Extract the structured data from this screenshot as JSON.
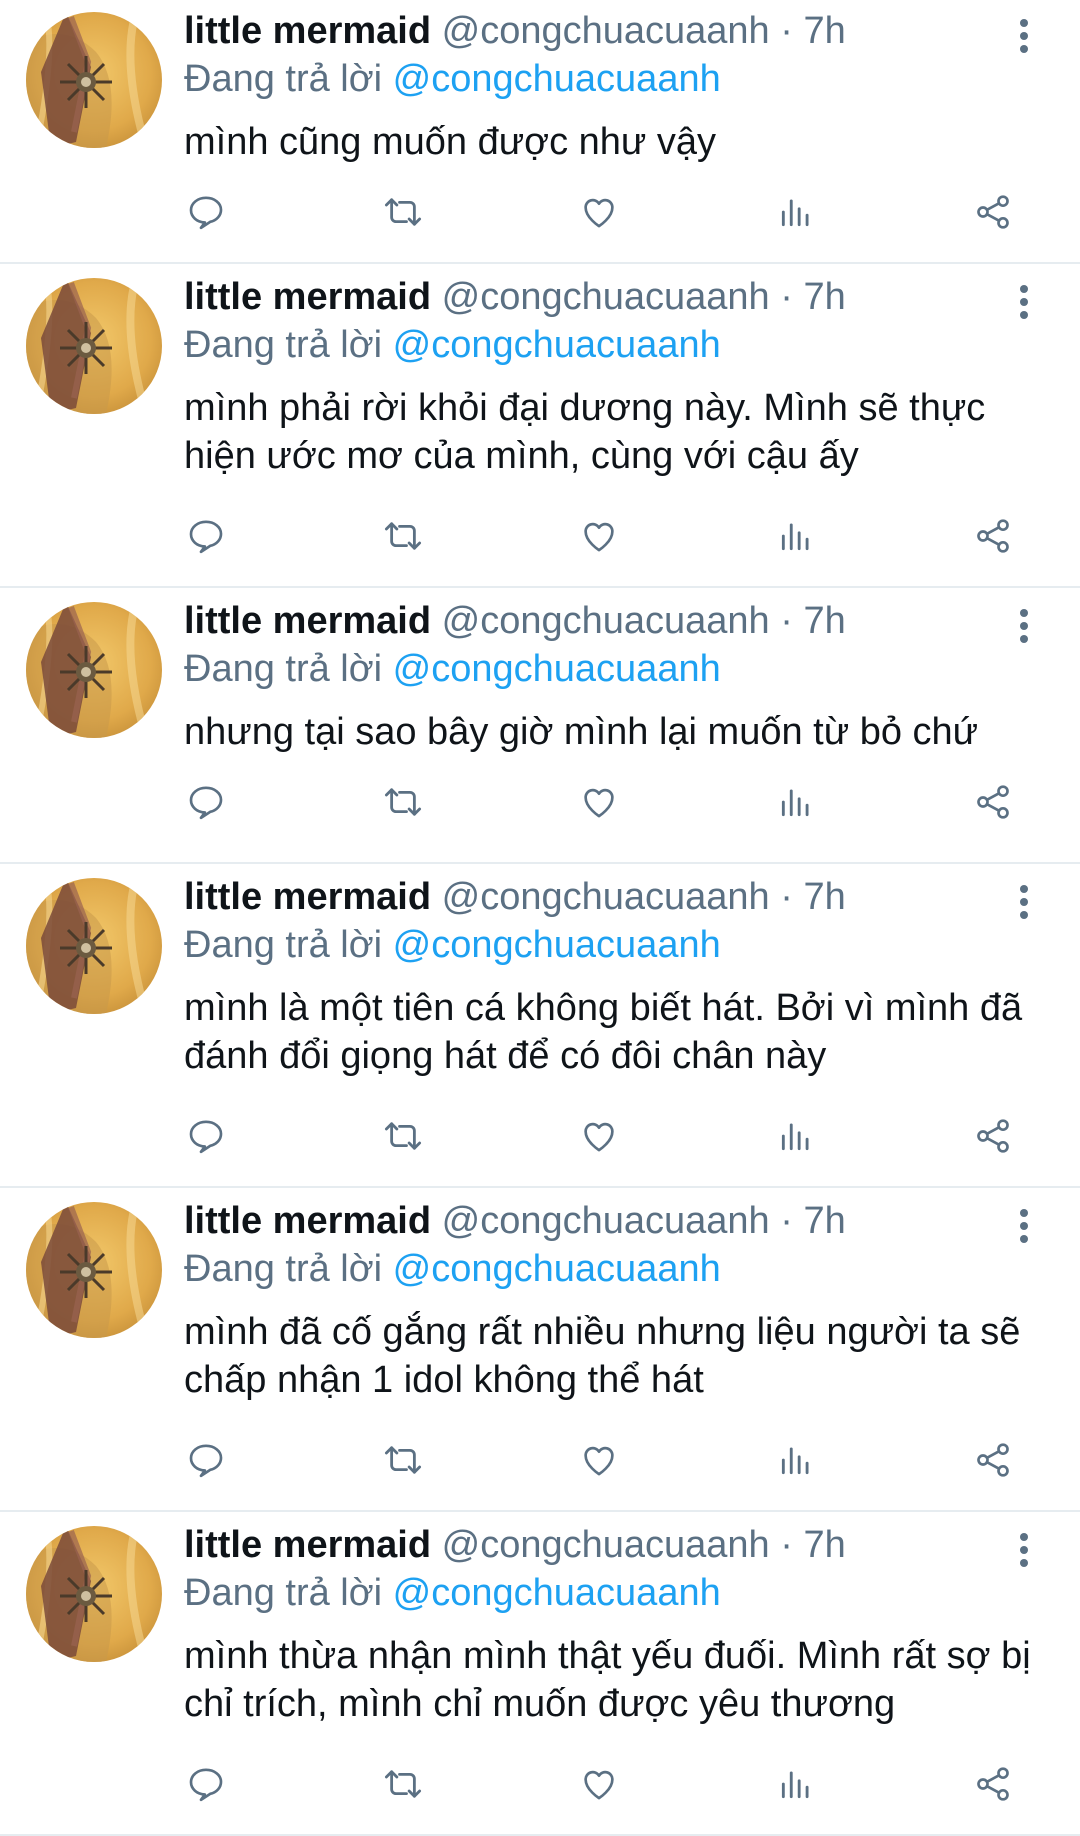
{
  "colors": {
    "name": "#0f1419",
    "secondary": "#5b7083",
    "link": "#1da1f2",
    "divider": "#e6ecf0"
  },
  "tweets": [
    {
      "display_name": "little mermaid",
      "handle": "@congchuacuaanh",
      "separator": "·",
      "time": "7h",
      "reply_prefix": "Đang trả lời",
      "reply_to": "@congchuacuaanh",
      "text": "mình cũng muốn được như vậy"
    },
    {
      "display_name": "little mermaid",
      "handle": "@congchuacuaanh",
      "separator": "·",
      "time": "7h",
      "reply_prefix": "Đang trả lời",
      "reply_to": "@congchuacuaanh",
      "text": "mình phải rời khỏi đại dương này. Mình sẽ thực hiện ước mơ của mình, cùng với cậu ấy"
    },
    {
      "display_name": "little mermaid",
      "handle": "@congchuacuaanh",
      "separator": "·",
      "time": "7h",
      "reply_prefix": "Đang trả lời",
      "reply_to": "@congchuacuaanh",
      "text": "nhưng tại sao bây giờ mình lại muốn từ bỏ chứ"
    },
    {
      "display_name": "little mermaid",
      "handle": "@congchuacuaanh",
      "separator": "·",
      "time": "7h",
      "reply_prefix": "Đang trả lời",
      "reply_to": "@congchuacuaanh",
      "text": "mình là một tiên cá không biết hát. Bởi vì mình đã đánh đổi giọng hát để có đôi chân này"
    },
    {
      "display_name": "little mermaid",
      "handle": "@congchuacuaanh",
      "separator": "·",
      "time": "7h",
      "reply_prefix": "Đang trả lời",
      "reply_to": "@congchuacuaanh",
      "text": "mình đã cố gắng rất nhiều nhưng liệu người ta sẽ chấp nhận 1 idol không thể hát"
    },
    {
      "display_name": "little mermaid",
      "handle": "@congchuacuaanh",
      "separator": "·",
      "time": "7h",
      "reply_prefix": "Đang trả lời",
      "reply_to": "@congchuacuaanh",
      "text": "mình thừa nhận mình thật yếu đuối. Mình rất sợ bị chỉ trích, mình chỉ muốn được yêu thương"
    }
  ],
  "icons": {
    "reply": "reply-icon",
    "retweet": "retweet-icon",
    "like": "heart-icon",
    "analytics": "analytics-icon",
    "share": "share-icon",
    "more": "more-vertical-icon"
  }
}
